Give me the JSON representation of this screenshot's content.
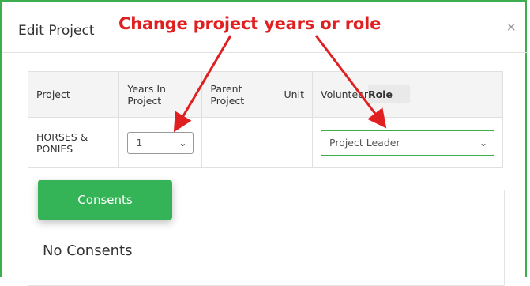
{
  "modal": {
    "title": "Edit Project",
    "close_symbol": "×"
  },
  "annotation": {
    "text": "Change project years or role",
    "color": "#e02020"
  },
  "table": {
    "headers": [
      "Project",
      "Years In Project",
      "Parent Project",
      "Unit",
      "Volunteer",
      "Role"
    ],
    "row": {
      "project": "HORSES & PONIES",
      "years": "1",
      "parent_project": "",
      "unit": "",
      "role": "Project Leader"
    }
  },
  "consents": {
    "button_label": "Consents",
    "empty_text": "No Consents"
  },
  "colors": {
    "accent": "#35b457",
    "border": "#3cae4e"
  }
}
